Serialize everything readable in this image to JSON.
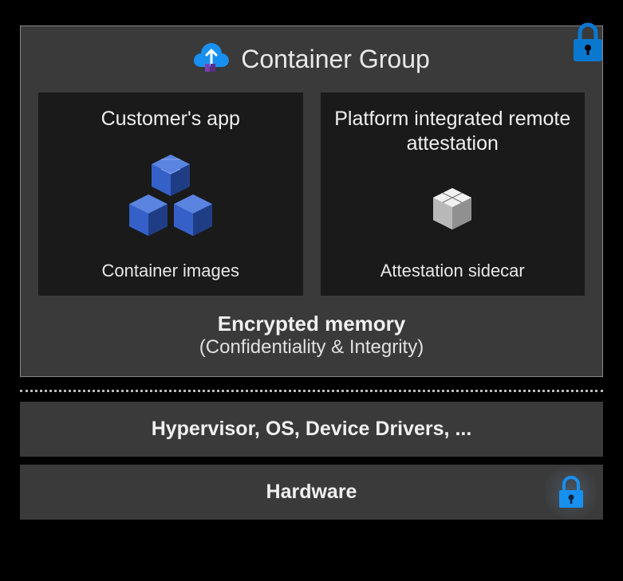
{
  "containerGroup": {
    "title": "Container Group",
    "customerApp": {
      "title": "Customer's app",
      "footer": "Container images"
    },
    "attestation": {
      "title": "Platform integrated remote attestation",
      "footer": "Attestation sidecar"
    },
    "encryptedMemory": {
      "title": "Encrypted memory",
      "subtitle": "(Confidentiality & Integrity)"
    }
  },
  "layers": {
    "hypervisor": "Hypervisor, OS, Device Drivers, ...",
    "hardware": "Hardware"
  },
  "colors": {
    "lockBlue": "#0b78d0",
    "boxBlue": "#3b6fd8"
  }
}
